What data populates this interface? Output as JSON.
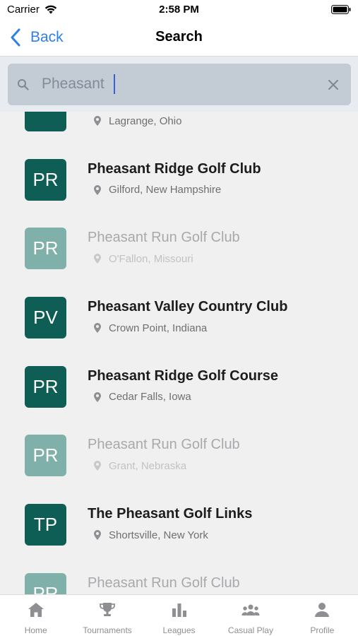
{
  "status_bar": {
    "carrier": "Carrier",
    "time": "2:58 PM"
  },
  "nav": {
    "back_label": "Back",
    "title": "Search"
  },
  "search": {
    "value": "Pheasant"
  },
  "results_partial": {
    "initials": "",
    "location": "Lagrange, Ohio"
  },
  "results": [
    {
      "initials": "PR",
      "name": "Pheasant Ridge Golf Club",
      "location": "Gilford, New Hampshire",
      "enabled": true
    },
    {
      "initials": "PR",
      "name": "Pheasant Run Golf Club",
      "location": "O'Fallon, Missouri",
      "enabled": false
    },
    {
      "initials": "PV",
      "name": "Pheasant Valley Country Club",
      "location": "Crown Point, Indiana",
      "enabled": true
    },
    {
      "initials": "PR",
      "name": "Pheasant Ridge Golf Course",
      "location": "Cedar Falls, Iowa",
      "enabled": true
    },
    {
      "initials": "PR",
      "name": "Pheasant Run Golf Club",
      "location": "Grant, Nebraska",
      "enabled": false
    },
    {
      "initials": "TP",
      "name": "The Pheasant Golf Links",
      "location": "Shortsville, New York",
      "enabled": true
    },
    {
      "initials": "PR",
      "name": "Pheasant Run Golf Club",
      "location": "",
      "enabled": false
    }
  ],
  "tabs": [
    {
      "label": "Home",
      "icon": "home-icon"
    },
    {
      "label": "Tournaments",
      "icon": "trophy-icon"
    },
    {
      "label": "Leagues",
      "icon": "bar-chart-icon"
    },
    {
      "label": "Casual Play",
      "icon": "group-icon"
    },
    {
      "label": "Profile",
      "icon": "person-icon"
    }
  ],
  "colors": {
    "accent": "#2f7fe6",
    "badge": "#0e5e56",
    "badge_disabled": "#7fb0a9",
    "search_box": "#c3cbd4",
    "background": "#f0f0f0"
  }
}
